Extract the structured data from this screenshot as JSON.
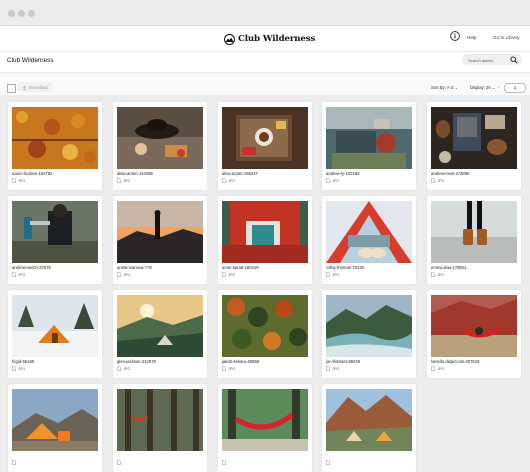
{
  "app": {
    "brand": "Club Wilderness",
    "help_label": "Help",
    "library_link": "Go to Library"
  },
  "page": {
    "title": "Club Wilderness"
  },
  "search": {
    "placeholder": "Search assets"
  },
  "toolbar": {
    "download_label": "Download",
    "sort_label": "Sort By: A-Z",
    "display_label": "Display: 20",
    "page_number": "1"
  },
  "assets": [
    {
      "name": "aaron-burden-154782",
      "type": "JPG",
      "icon": "file-icon"
    },
    {
      "name": "alisa-anton-144486",
      "type": "JPG",
      "icon": "file-icon"
    },
    {
      "name": "alisa-anton-156247",
      "type": "JPG",
      "icon": "file-icon"
    },
    {
      "name": "andrew-ly-102166",
      "type": "JPG",
      "icon": "file-icon"
    },
    {
      "name": "andrew-neel-274886",
      "type": "JPG",
      "icon": "file-icon"
    },
    {
      "name": "andrew-welch-37576",
      "type": "JPG",
      "icon": "file-icon"
    },
    {
      "name": "aneta-ivanova-778",
      "type": "JPG",
      "icon": "file-icon"
    },
    {
      "name": "anne-spratt-180419",
      "type": "JPG",
      "icon": "file-icon"
    },
    {
      "name": "colby-thomas-79130",
      "type": "JPG",
      "icon": "file-icon"
    },
    {
      "name": "emma-dau-179921",
      "type": "JPG",
      "icon": "file-icon"
    },
    {
      "name": "frigid-66160",
      "type": "JPG",
      "icon": "file-icon"
    },
    {
      "name": "glen-jackson-242978",
      "type": "JPG",
      "icon": "file-icon"
    },
    {
      "name": "jakob-sekora-40068",
      "type": "JPG",
      "icon": "file-icon"
    },
    {
      "name": "jon-flobrant-88429",
      "type": "JPG",
      "icon": "file-icon"
    },
    {
      "name": "lionello-delpiccolo-207618",
      "type": "JPG",
      "icon": "file-icon"
    },
    {
      "name": "",
      "type": "",
      "icon": "file-icon"
    },
    {
      "name": "",
      "type": "",
      "icon": "file-icon"
    },
    {
      "name": "",
      "type": "",
      "icon": "file-icon"
    },
    {
      "name": "",
      "type": "",
      "icon": "file-icon"
    }
  ],
  "colors": {
    "accent": "#1a1a1a",
    "background": "#ececec"
  }
}
